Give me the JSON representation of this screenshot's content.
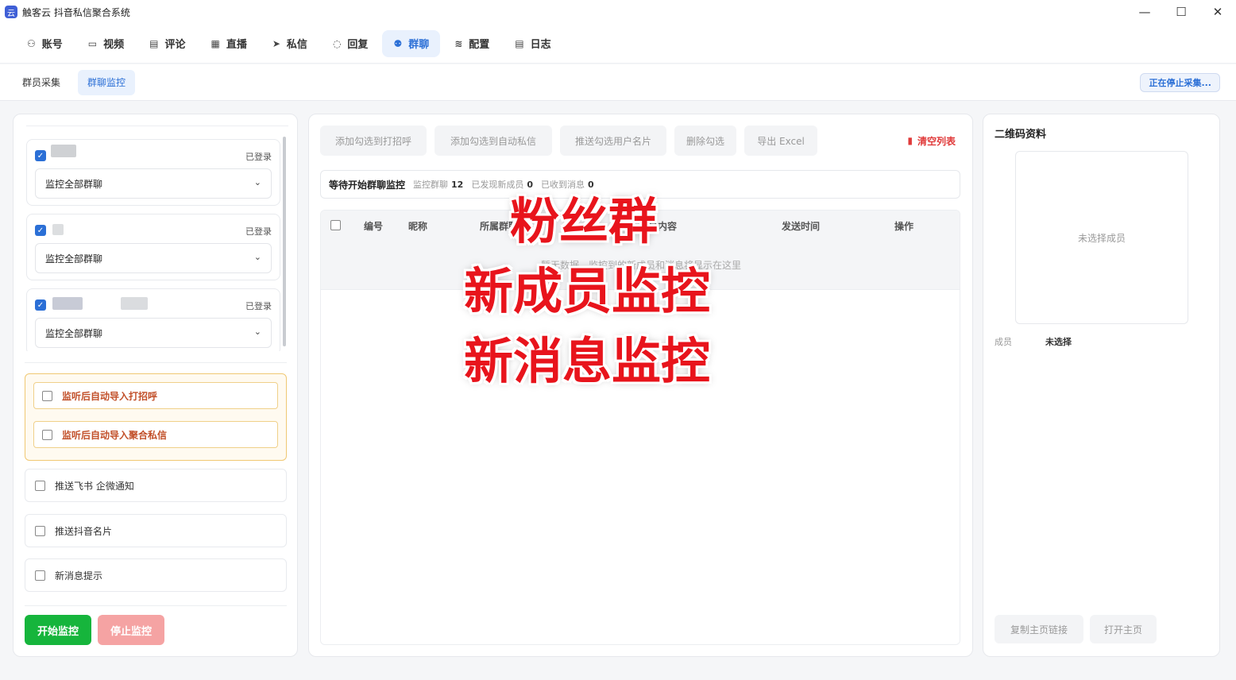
{
  "window": {
    "title": "触客云 抖音私信聚合系统",
    "logo_glyph": "云",
    "minimize": "—",
    "maximize": "☐",
    "close": "✕"
  },
  "nav": {
    "items": [
      {
        "label": "账号",
        "icon": "user-icon",
        "glyph": "⚇"
      },
      {
        "label": "视频",
        "icon": "video-icon",
        "glyph": "▭"
      },
      {
        "label": "评论",
        "icon": "comment-icon",
        "glyph": "▤"
      },
      {
        "label": "直播",
        "icon": "live-icon",
        "glyph": "▦"
      },
      {
        "label": "私信",
        "icon": "send-icon",
        "glyph": "➤"
      },
      {
        "label": "回复",
        "icon": "reply-icon",
        "glyph": "◌"
      },
      {
        "label": "群聊",
        "icon": "group-icon",
        "glyph": "⚉"
      },
      {
        "label": "配置",
        "icon": "settings-icon",
        "glyph": "≋"
      },
      {
        "label": "日志",
        "icon": "log-icon",
        "glyph": "▤"
      }
    ],
    "active": "群聊"
  },
  "subtabs": {
    "items": [
      "群员采集",
      "群聊监控"
    ],
    "active": "群聊监控",
    "stop_collect": "正在停止采集..."
  },
  "left": {
    "accounts": [
      {
        "status": "已登录",
        "select": "监控全部群聊"
      },
      {
        "status": "已登录",
        "select": "监控全部群聊"
      },
      {
        "status": "已登录",
        "select": "监控全部群聊"
      }
    ],
    "auto_options": [
      "监听后自动导入打招呼",
      "监听后自动导入聚合私信"
    ],
    "options": [
      "推送飞书 企微通知",
      "推送抖音名片",
      "新消息提示"
    ],
    "start_btn": "开始监控",
    "stop_btn": "停止监控",
    "check_glyph": "✓",
    "chevron_glyph": "⌄"
  },
  "mid": {
    "toolbar": [
      "添加勾选到打招呼",
      "添加勾选到自动私信",
      "推送勾选用户名片",
      "删除勾选",
      "导出 Excel"
    ],
    "clear_btn": "清空列表",
    "clear_glyph": "▮",
    "status": {
      "title": "等待开始群聊监控",
      "monitor_label": "监控群聊",
      "monitor_count": "12",
      "found_label": "已发现新成员",
      "found_count": "0",
      "msg_label": "已收到消息",
      "msg_count": "0"
    },
    "columns": [
      "编号",
      "昵称",
      "所属群聊",
      "消息内容",
      "发送时间",
      "操作"
    ],
    "empty_text": "暂无数据，监控到的新成员和消息将显示在这里"
  },
  "overlay": {
    "line1": "粉丝群",
    "line2": "新成员监控",
    "line3": "新消息监控"
  },
  "right": {
    "title": "二维码资料",
    "qr_placeholder": "未选择成员",
    "member_label": "成员",
    "member_value": "未选择",
    "copy_btn": "复制主页链接",
    "open_btn": "打开主页"
  }
}
